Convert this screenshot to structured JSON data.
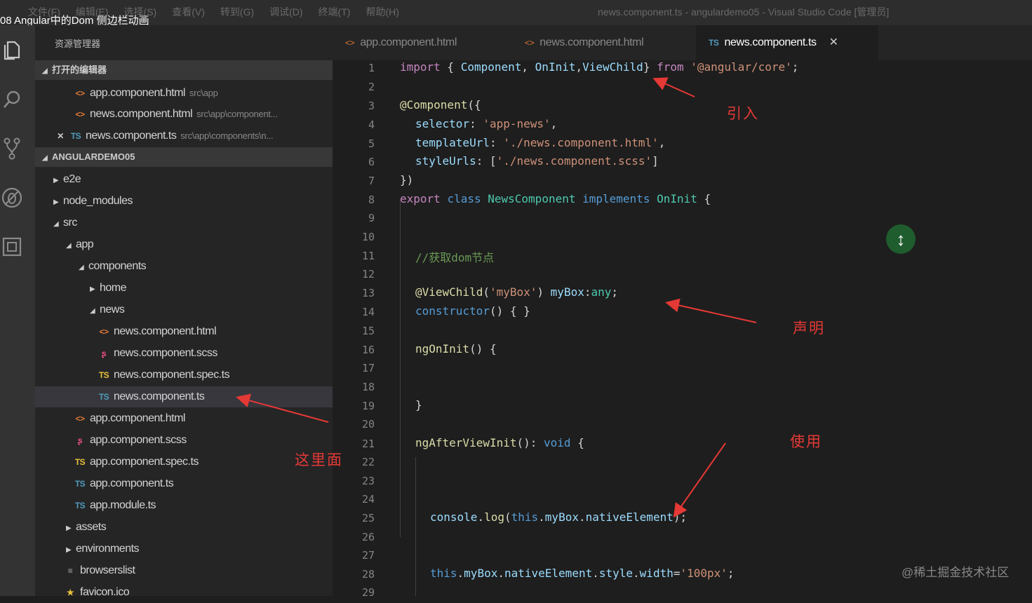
{
  "video_title": "08 Angular中的Dom 侧边栏动画",
  "window": {
    "menu": [
      "文件(F)",
      "编辑(E)",
      "选择(S)",
      "查看(V)",
      "转到(G)",
      "调试(D)",
      "终端(T)",
      "帮助(H)"
    ],
    "title": "news.component.ts - angulardemo05 - Visual Studio Code [管理员]"
  },
  "activity_icons": [
    "files-icon",
    "search-icon",
    "source-control-icon",
    "debug-icon",
    "extensions-icon"
  ],
  "sidebar": {
    "header": "资源管理器",
    "open_editors_label": "打开的编辑器",
    "open_editors": [
      {
        "icon": "html",
        "name": "app.component.html",
        "path": "src\\app"
      },
      {
        "icon": "html",
        "name": "news.component.html",
        "path": "src\\app\\component..."
      },
      {
        "icon": "ts",
        "name": "news.component.ts",
        "path": "src\\app\\components\\n..."
      }
    ],
    "project_label": "ANGULARDEMO05",
    "tree": [
      {
        "name": "e2e",
        "type": "folder",
        "open": false
      },
      {
        "name": "node_modules",
        "type": "folder",
        "open": false
      },
      {
        "name": "src",
        "type": "folder",
        "open": true
      },
      {
        "name": "app",
        "type": "folder",
        "open": true
      },
      {
        "name": "components",
        "type": "folder",
        "open": true
      },
      {
        "name": "home",
        "type": "folder",
        "open": false
      },
      {
        "name": "news",
        "type": "folder",
        "open": true
      },
      {
        "name": "news.component.html",
        "type": "html"
      },
      {
        "name": "news.component.scss",
        "type": "scss"
      },
      {
        "name": "news.component.spec.ts",
        "type": "ts"
      },
      {
        "name": "news.component.ts",
        "type": "ts"
      },
      {
        "name": "app.component.html",
        "type": "html"
      },
      {
        "name": "app.component.scss",
        "type": "scss"
      },
      {
        "name": "app.component.spec.ts",
        "type": "ts"
      },
      {
        "name": "app.component.ts",
        "type": "ts"
      },
      {
        "name": "app.module.ts",
        "type": "ts"
      },
      {
        "name": "assets",
        "type": "folder",
        "open": false
      },
      {
        "name": "environments",
        "type": "folder",
        "open": false
      },
      {
        "name": "browserslist",
        "type": "file"
      },
      {
        "name": "favicon.ico",
        "type": "ico"
      }
    ]
  },
  "tabs": [
    {
      "icon": "html",
      "label": "app.component.html",
      "active": false
    },
    {
      "icon": "html",
      "label": "news.component.html",
      "active": false
    },
    {
      "icon": "ts",
      "label": "news.component.ts",
      "active": true
    }
  ],
  "code_lines": [
    "1",
    "2",
    "3",
    "4",
    "5",
    "6",
    "7",
    "8",
    "9",
    "10",
    "11",
    "12",
    "13",
    "14",
    "15",
    "16",
    "17",
    "18",
    "19",
    "20",
    "21",
    "22",
    "23",
    "24",
    "25",
    "26",
    "27",
    "28",
    "29"
  ],
  "annotations": {
    "import": "引入",
    "declare": "声明",
    "use": "使用",
    "here": "这里面"
  },
  "watermark": "@稀土掘金技术社区",
  "colors": {
    "annotation": "#e53935",
    "html_icon": "#e37933",
    "ts_icon": "#519aba",
    "scss_icon": "#f55385"
  }
}
